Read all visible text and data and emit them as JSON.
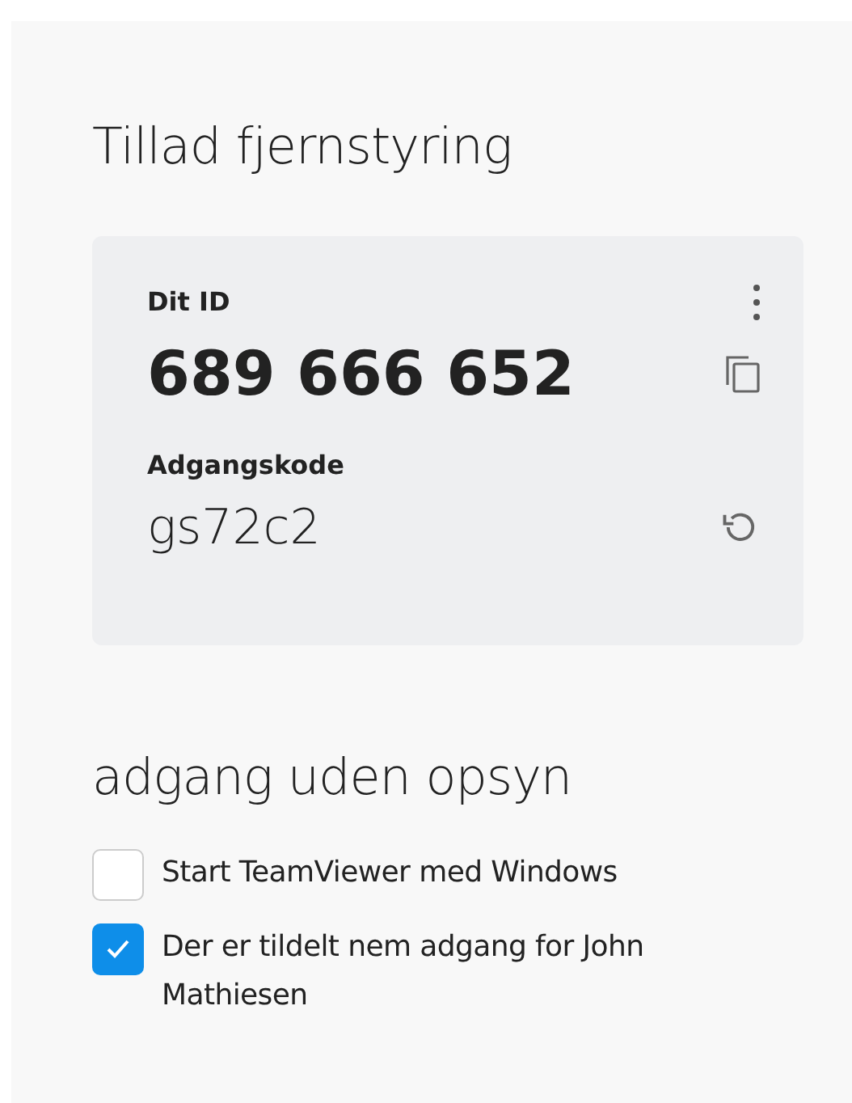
{
  "title": "Tillad fjernstyring",
  "card": {
    "id_label": "Dit ID",
    "id_value": "689 666 652",
    "password_label": "Adgangskode",
    "password_value": "gs72c2"
  },
  "unattended": {
    "title": "adgang uden opsyn",
    "options": [
      {
        "label": "Start TeamViewer med Windows",
        "checked": false
      },
      {
        "label": "Der er tildelt nem adgang for John Mathiesen",
        "checked": true
      }
    ]
  }
}
